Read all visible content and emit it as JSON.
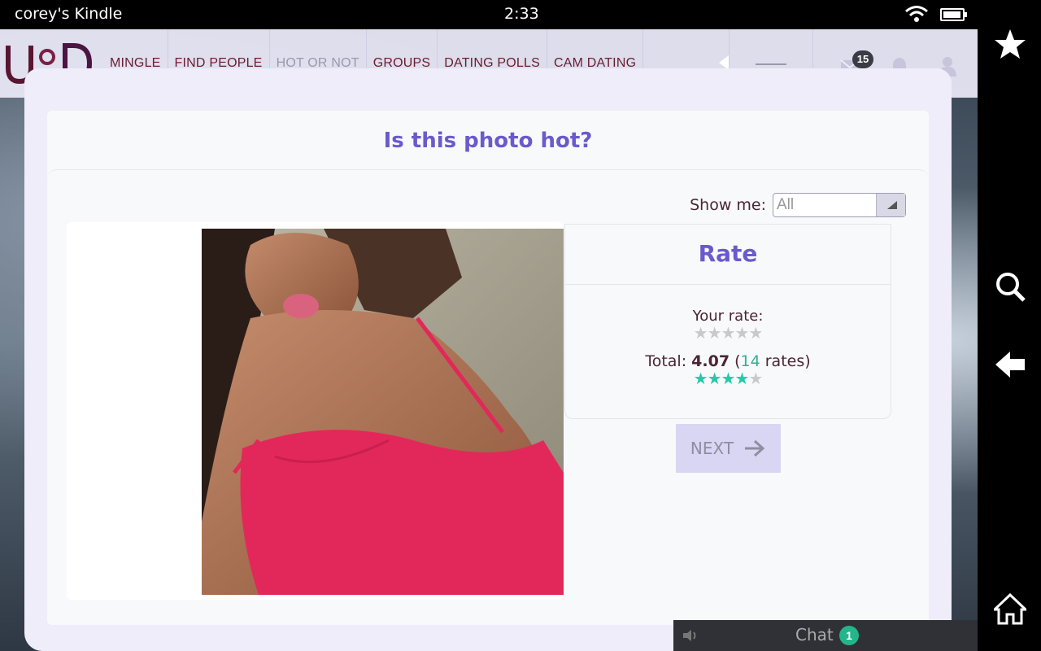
{
  "status_bar": {
    "device": "corey's Kindle",
    "time": "2:33"
  },
  "nav": {
    "items": [
      "MINGLE",
      "FIND PEOPLE",
      "HOT OR NOT",
      "GROUPS",
      "DATING POLLS",
      "CAM DATING"
    ],
    "messages_count": "15"
  },
  "page": {
    "title": "Is this photo hot?",
    "show_me_label": "Show me:",
    "show_me_value": "All"
  },
  "rate": {
    "heading": "Rate",
    "your_rate_label": "Your rate:",
    "your_rate_stars": 0,
    "total_label": "Total:",
    "total_value": "4.07",
    "rates_count": "14",
    "rates_label": "rates",
    "total_stars": 4
  },
  "next_label": "NEXT",
  "chat": {
    "label": "Chat",
    "count": "1"
  },
  "colors": {
    "accent": "#6a5acd",
    "nav_text": "#6b1d2f",
    "star_on": "#25c9a8"
  }
}
